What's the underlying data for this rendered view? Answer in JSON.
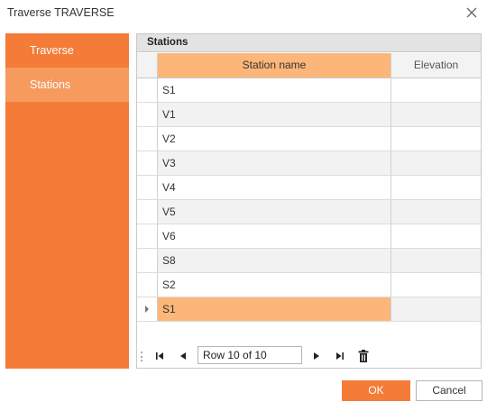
{
  "window": {
    "title": "Traverse TRAVERSE"
  },
  "sidebar": {
    "items": [
      {
        "label": "Traverse"
      },
      {
        "label": "Stations"
      }
    ]
  },
  "panel": {
    "title": "Stations"
  },
  "grid": {
    "columns": [
      "Station name",
      "Elevation"
    ],
    "rows": [
      {
        "name": "S1",
        "elevation": ""
      },
      {
        "name": "V1",
        "elevation": ""
      },
      {
        "name": "V2",
        "elevation": ""
      },
      {
        "name": "V3",
        "elevation": ""
      },
      {
        "name": "V4",
        "elevation": ""
      },
      {
        "name": "V5",
        "elevation": ""
      },
      {
        "name": "V6",
        "elevation": ""
      },
      {
        "name": "S8",
        "elevation": ""
      },
      {
        "name": "S2",
        "elevation": ""
      },
      {
        "name": "S1",
        "elevation": ""
      }
    ],
    "selected_row": 10
  },
  "navigator": {
    "position_text": "Row 10 of 10"
  },
  "buttons": {
    "ok": "OK",
    "cancel": "Cancel"
  },
  "icons": {
    "close": "close-icon",
    "first": "first-record-icon",
    "prev": "prev-record-icon",
    "next": "next-record-icon",
    "last": "last-record-icon",
    "delete": "trash-icon",
    "row_indicator": "row-indicator-icon"
  },
  "colors": {
    "accent": "#f47c38",
    "accent_light": "#f69a5e",
    "selection": "#fdb679"
  }
}
